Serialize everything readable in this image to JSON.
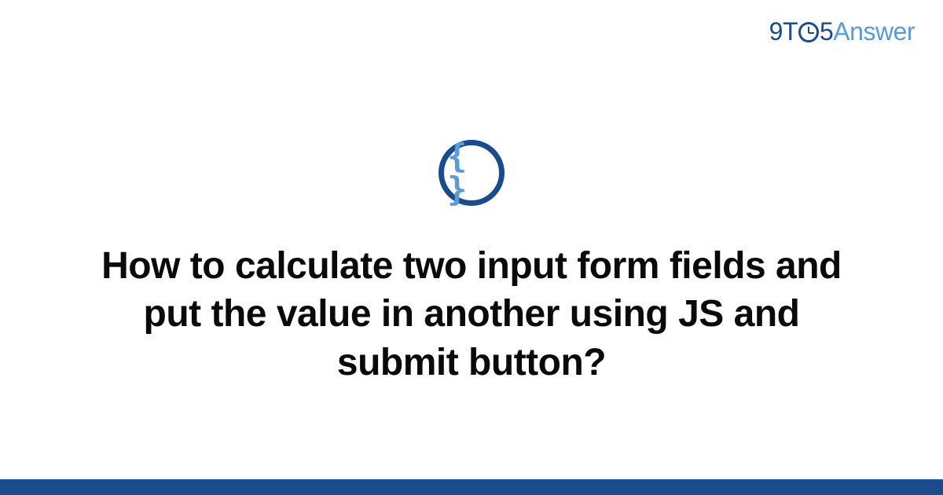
{
  "brand": {
    "part1": "9",
    "part2": "T",
    "part3": "5",
    "part4": "Answer"
  },
  "category": {
    "icon_name": "code-braces-icon",
    "glyph": "{ }"
  },
  "question": {
    "title": "How to calculate two input form fields and put the value in another using JS and submit button?"
  },
  "colors": {
    "primary": "#1a4b8c",
    "accent": "#5a9bd8"
  }
}
